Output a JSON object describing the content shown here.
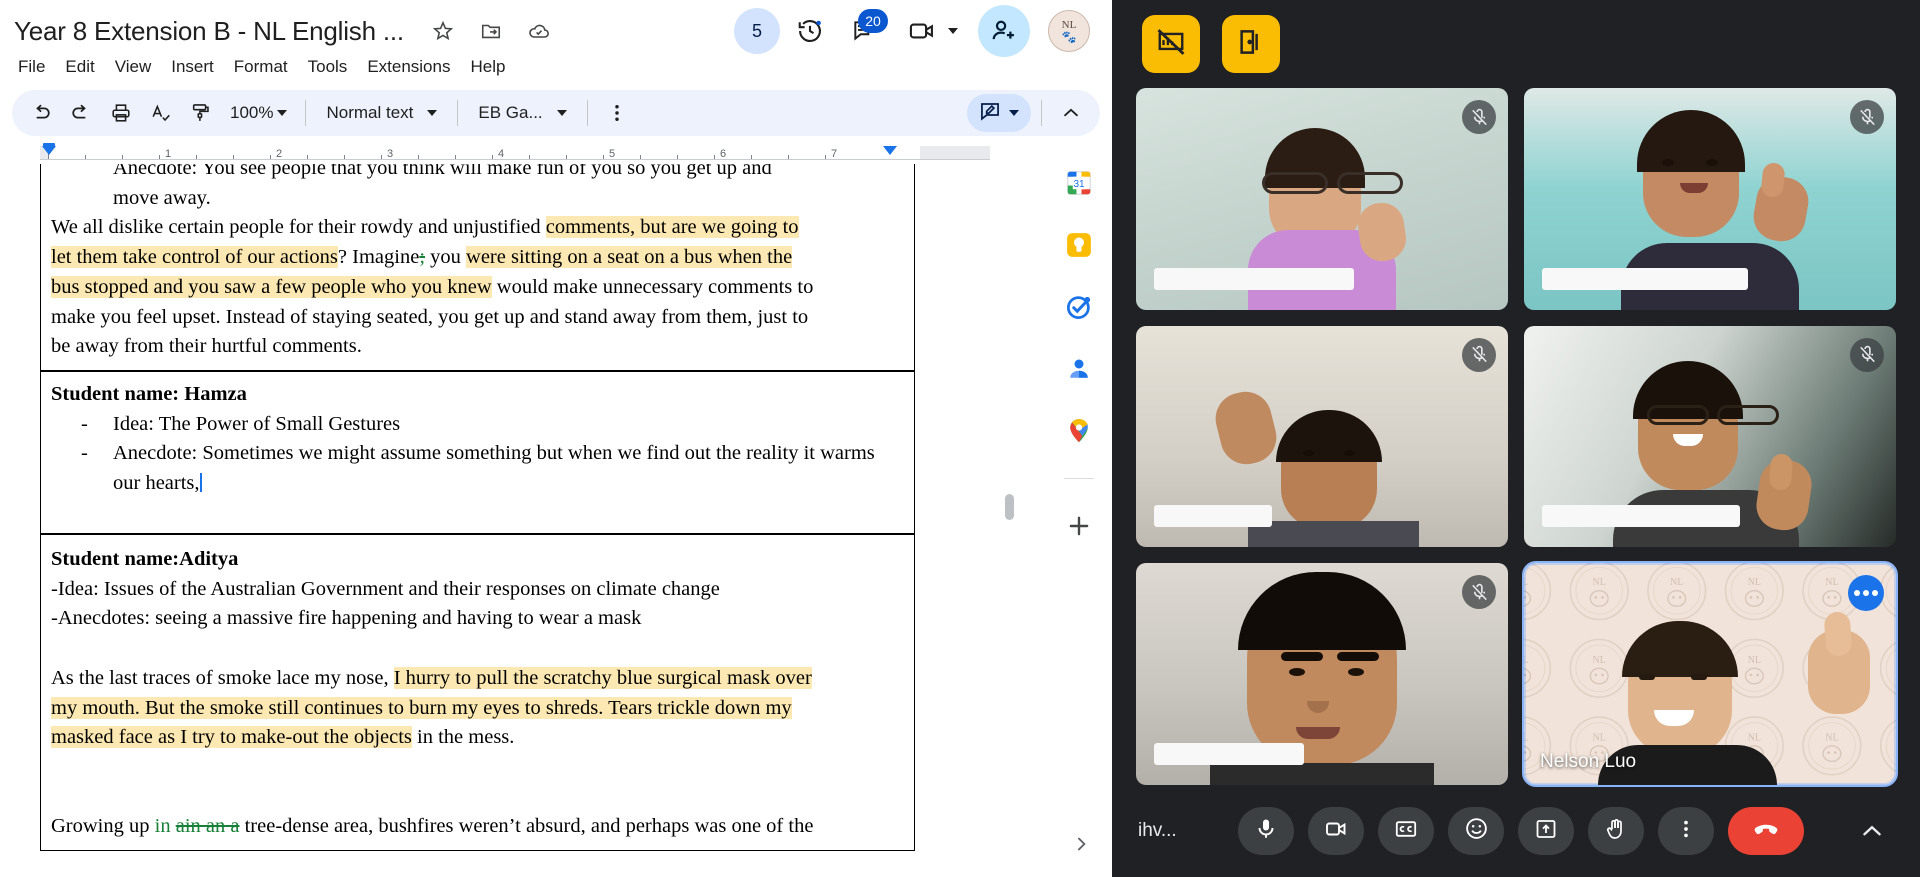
{
  "docs": {
    "title": "Year 8 Extension B - NL English ...",
    "title_icons": [
      "star-icon",
      "move-to-folder-icon",
      "cloud-saved-icon"
    ],
    "header_right": {
      "version_count": "5",
      "history_icon": "version-history-icon",
      "comments_icon": "comments-icon",
      "comments_badge": "20",
      "meet_icon": "video-camera-icon",
      "share_icon": "add-person-icon",
      "avatar_initials": "NL"
    },
    "menu": [
      "File",
      "Edit",
      "View",
      "Insert",
      "Format",
      "Tools",
      "Extensions",
      "Help"
    ],
    "toolbar": {
      "undo": "undo-icon",
      "redo": "redo-icon",
      "print": "print-icon",
      "spellcheck": "spelling-grammar-icon",
      "paint_format": "paint-format-icon",
      "zoom": "100%",
      "style": "Normal text",
      "font": "EB Ga...",
      "more": "more-options-icon",
      "mode": "editing-mode-icon",
      "collapse": "collapse-toolbar-icon"
    },
    "ruler": {
      "numbers": [
        "1",
        "2",
        "3",
        "4",
        "5",
        "6",
        "7"
      ]
    },
    "document": {
      "blocks": [
        {
          "id": "top-partial",
          "lines": [
            {
              "segments": [
                {
                  "t": "Anecdote: You see people that you think will make fun of you so you get up and",
                  "s": "plain"
                }
              ],
              "indent": true,
              "clipped": true
            },
            {
              "segments": [
                {
                  "t": "move away.",
                  "s": "plain"
                }
              ],
              "indent": true
            },
            {
              "segments": [
                {
                  "t": "We all dislike certain people for their rowdy and unjustified ",
                  "s": "plain"
                },
                {
                  "t": "comments, but are we going to",
                  "s": "hl"
                }
              ]
            },
            {
              "segments": [
                {
                  "t": "let them take control of our actions",
                  "s": "hl"
                },
                {
                  "t": "? Imagine",
                  "s": "plain"
                },
                {
                  "t": ";",
                  "s": "green-del"
                },
                {
                  "t": " you ",
                  "s": "plain"
                },
                {
                  "t": "were sitting on a seat on a bus when the",
                  "s": "hl"
                }
              ]
            },
            {
              "segments": [
                {
                  "t": "bus stopped and ",
                  "s": "hl"
                },
                {
                  "t": " you saw a few people who you knew",
                  "s": "hl"
                },
                {
                  "t": " would make unnecessary comments to",
                  "s": "plain"
                }
              ]
            },
            {
              "segments": [
                {
                  "t": "make you feel upset. Instead of staying seated, you get up and stand away from them, just to",
                  "s": "plain"
                }
              ]
            },
            {
              "segments": [
                {
                  "t": "be away from their hurtful comments.",
                  "s": "plain"
                }
              ]
            }
          ]
        },
        {
          "id": "hamza",
          "heading": "Student name: Hamza",
          "bullets": [
            "Idea: The Power of Small Gestures",
            "Anecdote: Sometimes we might assume something but when we find out the reality it warms our hearts,"
          ]
        },
        {
          "id": "aditya",
          "heading": "Student name:Aditya",
          "lines": [
            {
              "segments": [
                {
                  "t": "-Idea: Issues of the Australian Government and their responses on climate change",
                  "s": "plain"
                }
              ]
            },
            {
              "segments": [
                {
                  "t": "-Anecdotes: seeing a massive fire happening and having to wear a mask",
                  "s": "plain"
                }
              ]
            },
            {
              "segments": [
                {
                  "t": "",
                  "s": "plain"
                }
              ],
              "blank": true
            },
            {
              "segments": [
                {
                  "t": "As the last traces of smoke lace my nose, ",
                  "s": "plain"
                },
                {
                  "t": "I hurry to pull the scratchy blue surgical mask over",
                  "s": "hl"
                }
              ]
            },
            {
              "segments": [
                {
                  "t": "my mouth. But the smoke still continues to burn my eyes to shreds. Tears trickle down my",
                  "s": "hl"
                }
              ]
            },
            {
              "segments": [
                {
                  "t": "masked face as I try to make-out the objects",
                  "s": "hl"
                },
                {
                  "t": " in the mess.",
                  "s": "plain"
                }
              ]
            },
            {
              "segments": [
                {
                  "t": "",
                  "s": "plain"
                }
              ],
              "blank": true
            },
            {
              "segments": [
                {
                  "t": "Growing up ",
                  "s": "plain"
                },
                {
                  "t": "in ",
                  "s": "green-ins"
                },
                {
                  "t": "ain an a",
                  "s": "green-del"
                },
                {
                  "t": " tree-dense area, bushfires weren’t absurd, and perhaps was one of the",
                  "s": "plain"
                }
              ]
            }
          ]
        }
      ]
    },
    "side_rail": [
      {
        "name": "calendar-icon",
        "label": "31"
      },
      {
        "name": "keep-icon",
        "label": ""
      },
      {
        "name": "tasks-icon",
        "label": ""
      },
      {
        "name": "contacts-icon",
        "label": ""
      },
      {
        "name": "maps-icon",
        "label": ""
      },
      {
        "name": "add-addon-icon",
        "label": "+"
      }
    ],
    "rail_expand": "expand-side-panel-icon"
  },
  "meet": {
    "top_buttons": [
      {
        "name": "stop-presenting-icon"
      },
      {
        "name": "leave-room-icon"
      }
    ],
    "tiles": [
      {
        "id": "t1",
        "name": "",
        "muted": true,
        "active": false,
        "bg": "#cfd9d4",
        "shirt": "#c98bd6",
        "skin": "#d9a883",
        "hair": "#2b1d14"
      },
      {
        "id": "t2",
        "name": "",
        "muted": true,
        "active": false,
        "bg": "#8fd3d1",
        "shirt": "#2e2b3a",
        "skin": "#c48a63",
        "hair": "#241810"
      },
      {
        "id": "t3",
        "name": "",
        "muted": true,
        "active": false,
        "bg": "#d3cfc6",
        "shirt": "#4a4a52",
        "skin": "#b97f54",
        "hair": "#1c130c"
      },
      {
        "id": "t4",
        "name": "",
        "muted": true,
        "active": false,
        "bg": "#cdd4cf",
        "shirt": "#3a3a3a",
        "skin": "#c08a5c",
        "hair": "#1a110a"
      },
      {
        "id": "t5",
        "name": "",
        "muted": true,
        "active": false,
        "bg": "#c9c6c0",
        "shirt": "#2b2b2b",
        "skin": "#c08a5e",
        "hair": "#110c07"
      },
      {
        "id": "t6",
        "name": "Nelson Luo",
        "muted": false,
        "active": true,
        "bg": "#f0e2d8",
        "shirt": "#1b1b1b",
        "skin": "#e0b48c",
        "hair": "#2a1d12"
      }
    ],
    "bottom": {
      "meeting_id": "ihv...",
      "controls": [
        {
          "name": "microphone-button",
          "icon": "mic-icon"
        },
        {
          "name": "camera-button",
          "icon": "video-icon"
        },
        {
          "name": "captions-button",
          "icon": "cc-icon"
        },
        {
          "name": "reactions-button",
          "icon": "emoji-icon"
        },
        {
          "name": "present-button",
          "icon": "present-screen-icon"
        },
        {
          "name": "raise-hand-button",
          "icon": "hand-icon"
        },
        {
          "name": "more-options-button",
          "icon": "more-vertical-icon"
        },
        {
          "name": "leave-call-button",
          "icon": "hangup-icon"
        }
      ],
      "expand": "expand-panel-icon"
    }
  },
  "colors": {
    "docs_toolbar_bg": "#edf2fc",
    "accent_blue": "#0b57d0",
    "highlight_yellow": "#fce8b2",
    "meet_bg": "#202124",
    "meet_yellow": "#fbbc04",
    "hangup_red": "#ea4335",
    "active_tile": "#8ab4f8"
  }
}
